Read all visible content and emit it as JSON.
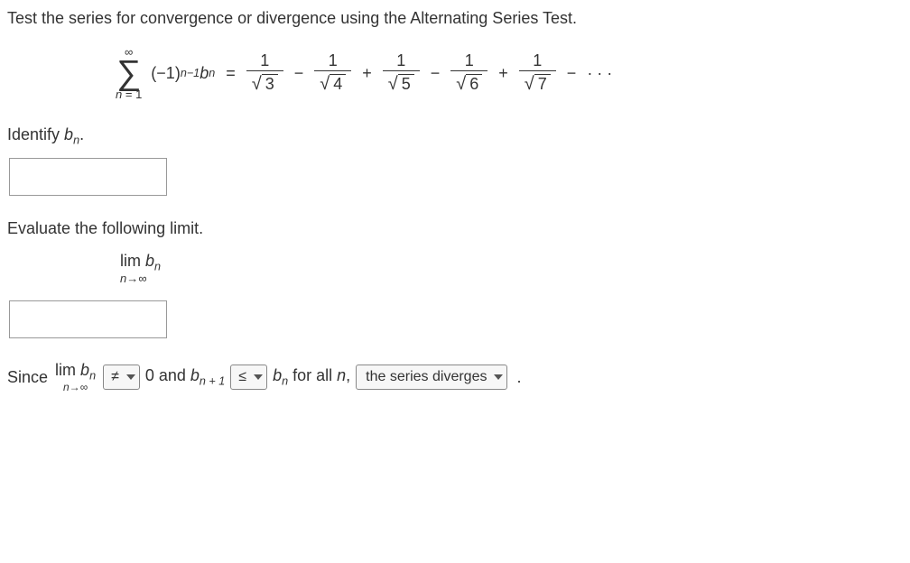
{
  "question": "Test the series for convergence or divergence using the Alternating Series Test.",
  "series": {
    "upper": "∞",
    "lower_lhs": "n",
    "lower_eq": " = ",
    "lower_rhs": "1",
    "summand_open": "(−1)",
    "summand_exp": "n−1",
    "summand_b": "b",
    "summand_bsub": "n",
    "eq": "=",
    "denoms": [
      "3",
      "4",
      "5",
      "6",
      "7"
    ],
    "num": "1",
    "minus": "−",
    "plus": "+",
    "dots": "· · ·"
  },
  "identify": {
    "label_pre": "Identify ",
    "b": "b",
    "bsub": "n",
    "label_post": "."
  },
  "evaluate_label": "Evaluate the following limit.",
  "limit": {
    "lim": "lim",
    "sub": "n→∞",
    "b": "b",
    "bsub": "n"
  },
  "final": {
    "since": "Since ",
    "lim": "lim",
    "limsub": "n→∞",
    "b1": "b",
    "b1sub": "n",
    "dd1": "≠",
    "mid1": " 0 and ",
    "b2": "b",
    "b2sub": "n + 1",
    "dd2": "≤",
    "b3": "b",
    "b3sub": "n",
    "foralln": " for all ",
    "nvar": "n",
    "comma": ", ",
    "dd3": "the series diverges",
    "period": "."
  }
}
